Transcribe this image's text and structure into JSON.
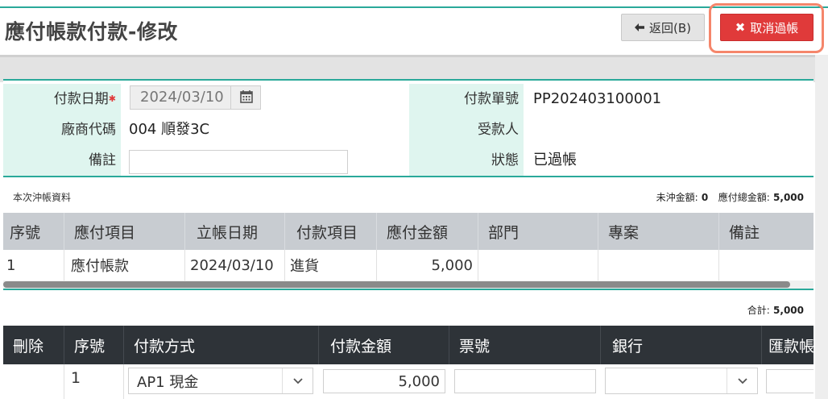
{
  "header": {
    "title": "應付帳款付款-修改",
    "back_label": "返回(B)",
    "cancel_label": "取消過帳"
  },
  "form": {
    "pay_date_label": "付款日期",
    "pay_date_value": "2024/03/10",
    "pay_no_label": "付款單號",
    "pay_no_value": "PP202403100001",
    "vendor_label": "廠商代碼",
    "vendor_value": "004 順發3C",
    "payee_label": "受款人",
    "payee_value": "",
    "memo_label": "備註",
    "memo_value": "",
    "status_label": "狀態",
    "status_value": "已過帳"
  },
  "summary": {
    "section_label": "本次沖帳資料",
    "unoffset_label": "未沖金額:",
    "unoffset_value": "0",
    "total_payable_label": "應付總金額:",
    "total_payable_value": "5,000"
  },
  "offset_table": {
    "columns": [
      "序號",
      "應付項目",
      "立帳日期",
      "付款項目",
      "應付金額",
      "部門",
      "專案",
      "備註"
    ],
    "rows": [
      [
        "1",
        "應付帳款",
        "2024/03/10",
        "進貨",
        "5,000",
        "",
        "",
        ""
      ]
    ]
  },
  "total": {
    "label": "合計:",
    "value": "5,000"
  },
  "payment_table": {
    "columns": [
      "刪除",
      "序號",
      "付款方式",
      "付款金額",
      "票號",
      "銀行",
      "匯款帳"
    ],
    "rows": [
      {
        "seq": "1",
        "method": "AP1 現金",
        "amount": "5,000",
        "cheque_no": "",
        "bank": ""
      }
    ]
  },
  "icons": {
    "back": "arrow-left-icon",
    "cancel": "close-icon",
    "date": "calendar-icon",
    "dropdown": "chevron-down-icon"
  },
  "colors": {
    "accent": "#2aa99a",
    "cancel_button": "#e03a3a",
    "highlight_ring": "#f5866b",
    "label_bg": "#dff5ef",
    "dark_header": "#2e3338"
  }
}
